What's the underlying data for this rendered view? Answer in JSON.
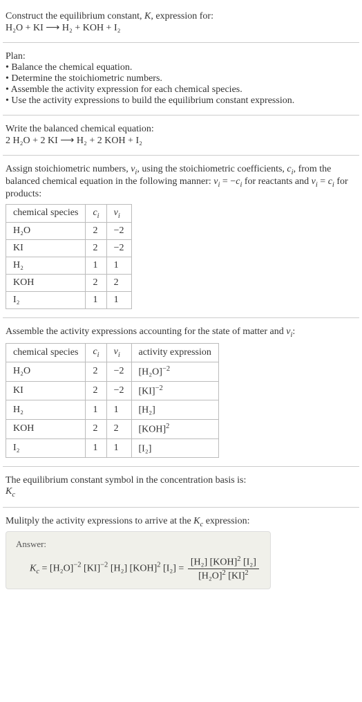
{
  "intro": {
    "line1": "Construct the equilibrium constant, ",
    "K": "K",
    "line1b": ", expression for:",
    "equation": "H₂O + KI ⟶ H₂ + KOH + I₂"
  },
  "plan": {
    "heading": "Plan:",
    "bullet1": "• Balance the chemical equation.",
    "bullet2": "• Determine the stoichiometric numbers.",
    "bullet3": "• Assemble the activity expression for each chemical species.",
    "bullet4": "• Use the activity expressions to build the equilibrium constant expression."
  },
  "balanced": {
    "heading": "Write the balanced chemical equation:",
    "equation": "2 H₂O + 2 KI ⟶ H₂ + 2 KOH + I₂"
  },
  "stoich": {
    "text1": "Assign stoichiometric numbers, ",
    "nu": "ν",
    "i": "i",
    "text2": ", using the stoichiometric coefficients, ",
    "c": "c",
    "text3": ", from the balanced chemical equation in the following manner: ",
    "rel1a": "ν",
    "rel1b": " = −",
    "rel1c": "c",
    "text4": " for reactants and ",
    "rel2a": "ν",
    "rel2b": " = ",
    "rel2c": "c",
    "text5": " for products:",
    "table": {
      "h1": "chemical species",
      "h2": "c",
      "h3": "ν",
      "rows": [
        {
          "sp": "H₂O",
          "c": "2",
          "v": "−2"
        },
        {
          "sp": "KI",
          "c": "2",
          "v": "−2"
        },
        {
          "sp": "H₂",
          "c": "1",
          "v": "1"
        },
        {
          "sp": "KOH",
          "c": "2",
          "v": "2"
        },
        {
          "sp": "I₂",
          "c": "1",
          "v": "1"
        }
      ]
    }
  },
  "activity": {
    "heading": "Assemble the activity expressions accounting for the state of matter and ",
    "nu": "ν",
    "i": "i",
    "colon": ":",
    "table": {
      "h1": "chemical species",
      "h2": "c",
      "h3": "ν",
      "h4": "activity expression",
      "rows": [
        {
          "sp": "H₂O",
          "c": "2",
          "v": "−2",
          "aBase": "[H₂O]",
          "aExp": "−2"
        },
        {
          "sp": "KI",
          "c": "2",
          "v": "−2",
          "aBase": "[KI]",
          "aExp": "−2"
        },
        {
          "sp": "H₂",
          "c": "1",
          "v": "1",
          "aBase": "[H₂]",
          "aExp": ""
        },
        {
          "sp": "KOH",
          "c": "2",
          "v": "2",
          "aBase": "[KOH]",
          "aExp": "2"
        },
        {
          "sp": "I₂",
          "c": "1",
          "v": "1",
          "aBase": "[I₂]",
          "aExp": ""
        }
      ]
    }
  },
  "symbol": {
    "heading": "The equilibrium constant symbol in the concentration basis is:",
    "K": "K",
    "c": "c"
  },
  "final": {
    "heading": "Mulitply the activity expressions to arrive at the ",
    "K": "K",
    "c": "c",
    "heading2": " expression:",
    "answerLabel": "Answer:",
    "Kc": "K",
    "KcSub": "c",
    "eq": " = ",
    "t1": "[H₂O]",
    "e1": "−2",
    "t2": " [KI]",
    "e2": "−2",
    "t3": " [H₂] [KOH]",
    "e3": "2",
    "t4": " [I₂] = ",
    "num1": "[H₂] [KOH]",
    "numE": "2",
    "num2": " [I₂]",
    "den1": "[H₂O]",
    "denE1": "2",
    "den2": " [KI]",
    "denE2": "2"
  }
}
